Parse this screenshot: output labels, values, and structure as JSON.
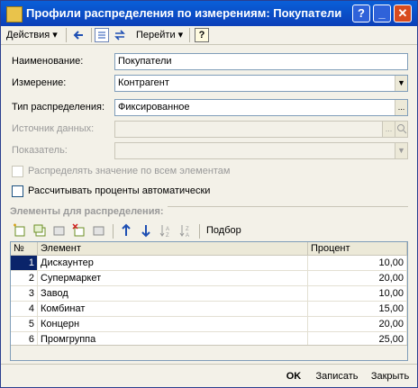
{
  "window": {
    "title": "Профили распределения по измерениям: Покупатели",
    "help_glyph": "?",
    "min_glyph": "_",
    "close_glyph": "✕"
  },
  "toolbar": {
    "actions_label": "Действия",
    "goto_label": "Перейти",
    "help_glyph": "?",
    "dropdown_glyph": "▾"
  },
  "form": {
    "name_label": "Наименование:",
    "name_value": "Покупатели",
    "dimension_label": "Измерение:",
    "dimension_value": "Контрагент",
    "distribution_type_label": "Тип распределения:",
    "distribution_type_value": "Фиксированное",
    "data_source_label": "Источник данных:",
    "data_source_value": "",
    "indicator_label": "Показатель:",
    "indicator_value": "",
    "distribute_all_label": "Распределять значение по всем элементам",
    "distribute_all_checked": false,
    "auto_percent_label": "Рассчитывать проценты автоматически",
    "auto_percent_checked": false,
    "ellipsis": "...",
    "dropdown_glyph": "▼"
  },
  "elements": {
    "section_title": "Элементы для распределения:",
    "pick_label": "Подбор",
    "columns": [
      "№",
      "Элемент",
      "Процент"
    ],
    "rows": [
      {
        "n": "1",
        "element": "Дискаунтер",
        "percent": "10,00"
      },
      {
        "n": "2",
        "element": "Супермаркет",
        "percent": "20,00"
      },
      {
        "n": "3",
        "element": "Завод",
        "percent": "10,00"
      },
      {
        "n": "4",
        "element": "Комбинат",
        "percent": "15,00"
      },
      {
        "n": "5",
        "element": "Концерн",
        "percent": "20,00"
      },
      {
        "n": "6",
        "element": "Промгруппа",
        "percent": "25,00"
      }
    ]
  },
  "footer": {
    "ok_label": "OK",
    "save_label": "Записать",
    "close_label": "Закрыть"
  },
  "colors": {
    "titlebar": "#0b3fb8",
    "selected_cell": "#0a246a"
  }
}
